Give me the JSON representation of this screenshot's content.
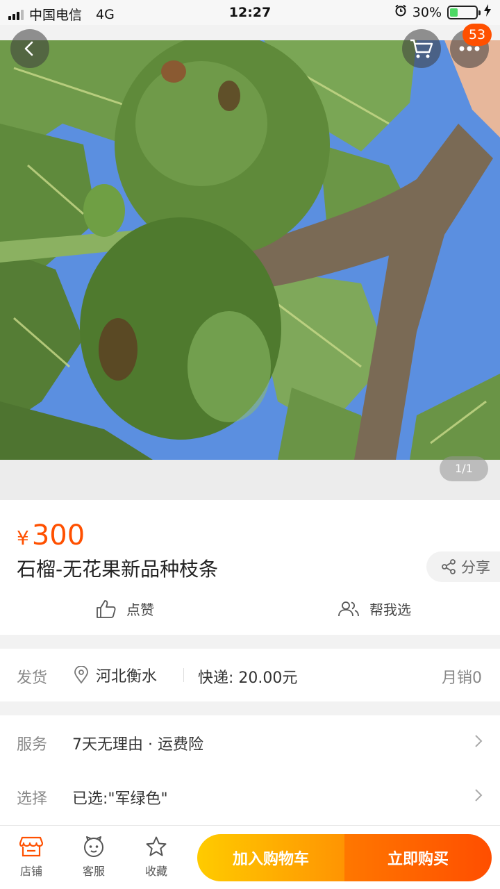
{
  "status_bar": {
    "carrier": "中国电信",
    "network": "4G",
    "time": "12:27",
    "battery": "30%",
    "battery_level": 0.3
  },
  "nav": {
    "back_icon": "back-arrow-icon",
    "cart_icon": "cart-icon",
    "more_icon": "more-dots-icon",
    "badge_count": "53"
  },
  "gallery": {
    "counter": "1/1"
  },
  "product": {
    "price_symbol": "¥",
    "price": "300",
    "title": "石榴-无花果新品种枝条",
    "share_label": "分享",
    "like_label": "点赞",
    "help_choose_label": "帮我选"
  },
  "shipping": {
    "label": "发货",
    "location": "河北衡水",
    "fee": "快递: 20.00元",
    "monthly_sales": "月销0"
  },
  "service": {
    "service_label": "服务",
    "service_value": "7天无理由 · 运费险",
    "select_label": "选择",
    "select_value": "已选:\"军绿色\""
  },
  "bottom_bar": {
    "shop_label": "店铺",
    "customer_service_label": "客服",
    "favorite_label": "收藏",
    "add_to_cart_label": "加入购物车",
    "buy_now_label": "立即购买"
  },
  "colors": {
    "accent": "#ff5000",
    "cart_button": "#ffb400",
    "buy_button": "#ff5a00",
    "battery_fill": "#4cd964"
  }
}
